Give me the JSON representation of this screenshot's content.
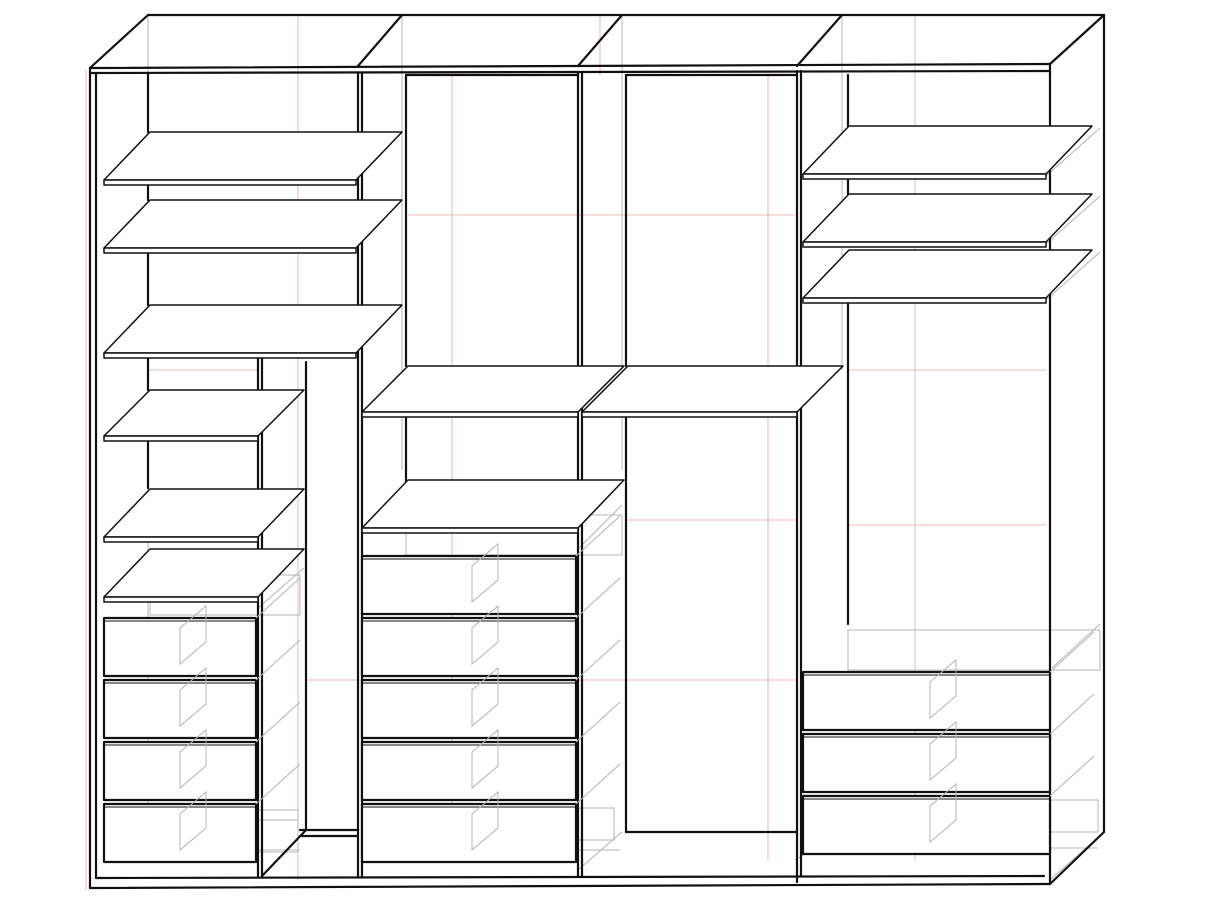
{
  "drawing": {
    "kind": "wireframe wardrobe line drawing",
    "colors": {
      "ink": "#111111",
      "ghost": "#b4b4b4",
      "guide": "#e8a3a3",
      "background": "#ffffff"
    },
    "sections": [
      {
        "id": "section-1",
        "open_shelves": 6,
        "drawers": 4,
        "has_side_partition": true
      },
      {
        "id": "section-2",
        "open_shelves": 2,
        "drawers": 5
      },
      {
        "id": "section-3",
        "open_shelves": 1,
        "drawers": 0
      },
      {
        "id": "section-4",
        "open_shelves": 3,
        "drawers": 3
      }
    ]
  }
}
